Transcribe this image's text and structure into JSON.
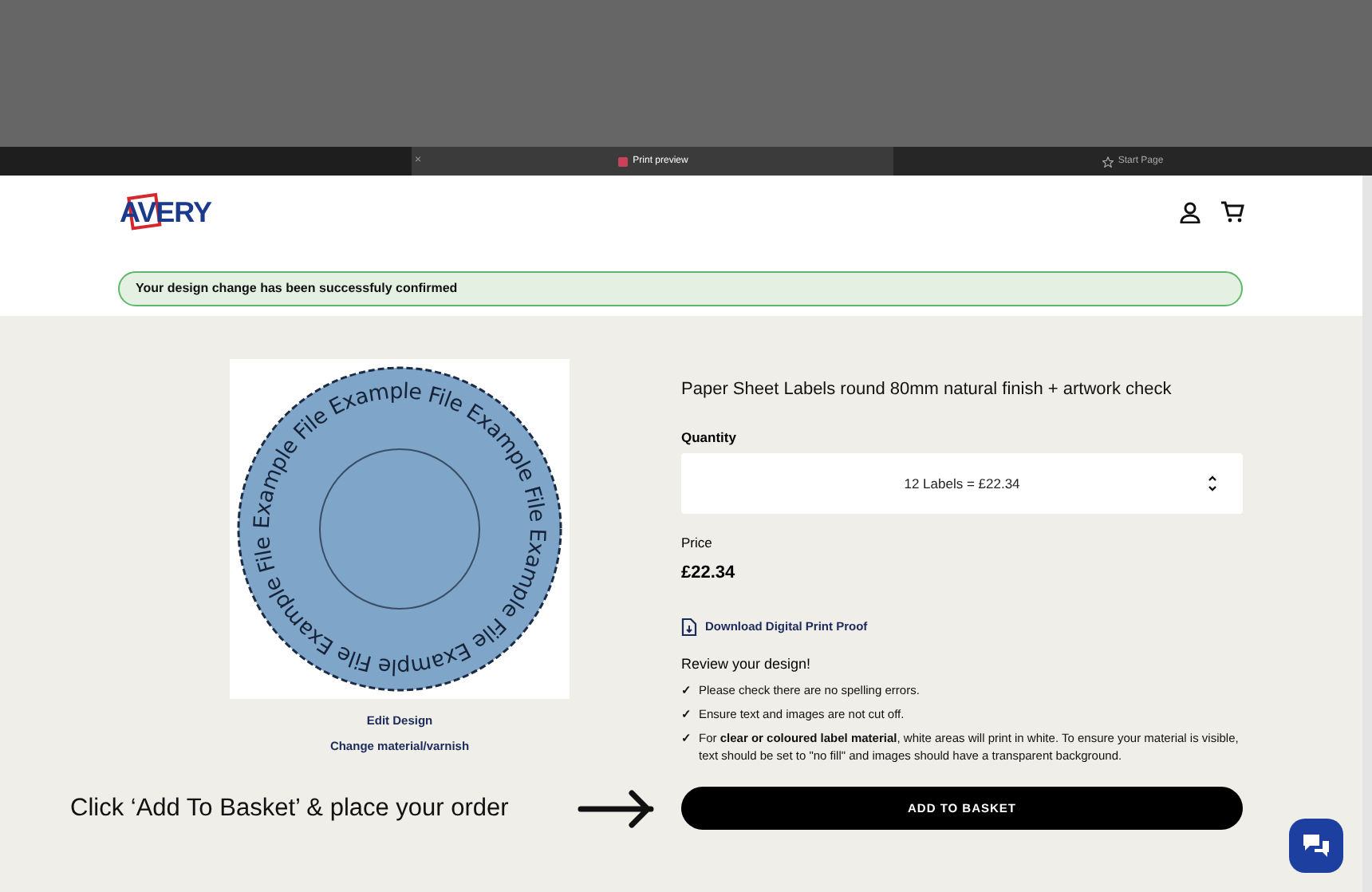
{
  "browser": {
    "tabs": [
      {
        "label": "Print preview",
        "close": "×",
        "selected": true
      },
      {
        "label": "Start Page",
        "selected": false
      }
    ]
  },
  "header": {
    "logo": "AVERY"
  },
  "alert": {
    "message": "Your design change has been successfuly confirmed"
  },
  "design": {
    "label_text": "Example File Example File Example File Example File Example File Example File",
    "links": [
      "Edit Design",
      "Change material/varnish"
    ]
  },
  "product": {
    "title": "Paper Sheet Labels round 80mm natural finish + artwork check",
    "quantity_label": "Quantity",
    "quantity_value": "12 Labels = £22.34",
    "price_label": "Price",
    "price": "£22.34",
    "download": "Download Digital Print Proof",
    "review_title": "Review your design!",
    "checks": [
      {
        "mark": "✓",
        "text": "Please check there are no spelling errors."
      },
      {
        "mark": "✓",
        "text": "Ensure text and images are not cut off."
      },
      {
        "mark": "✓",
        "text": "For **clear or coloured label material**, white areas will print in white. To ensure your material is visible, text should be set to \"no fill\" and images should have a transparent background."
      }
    ],
    "add_button": "ADD TO BASKET"
  },
  "callout": "Click ‘Add To Basket’ & place your order"
}
